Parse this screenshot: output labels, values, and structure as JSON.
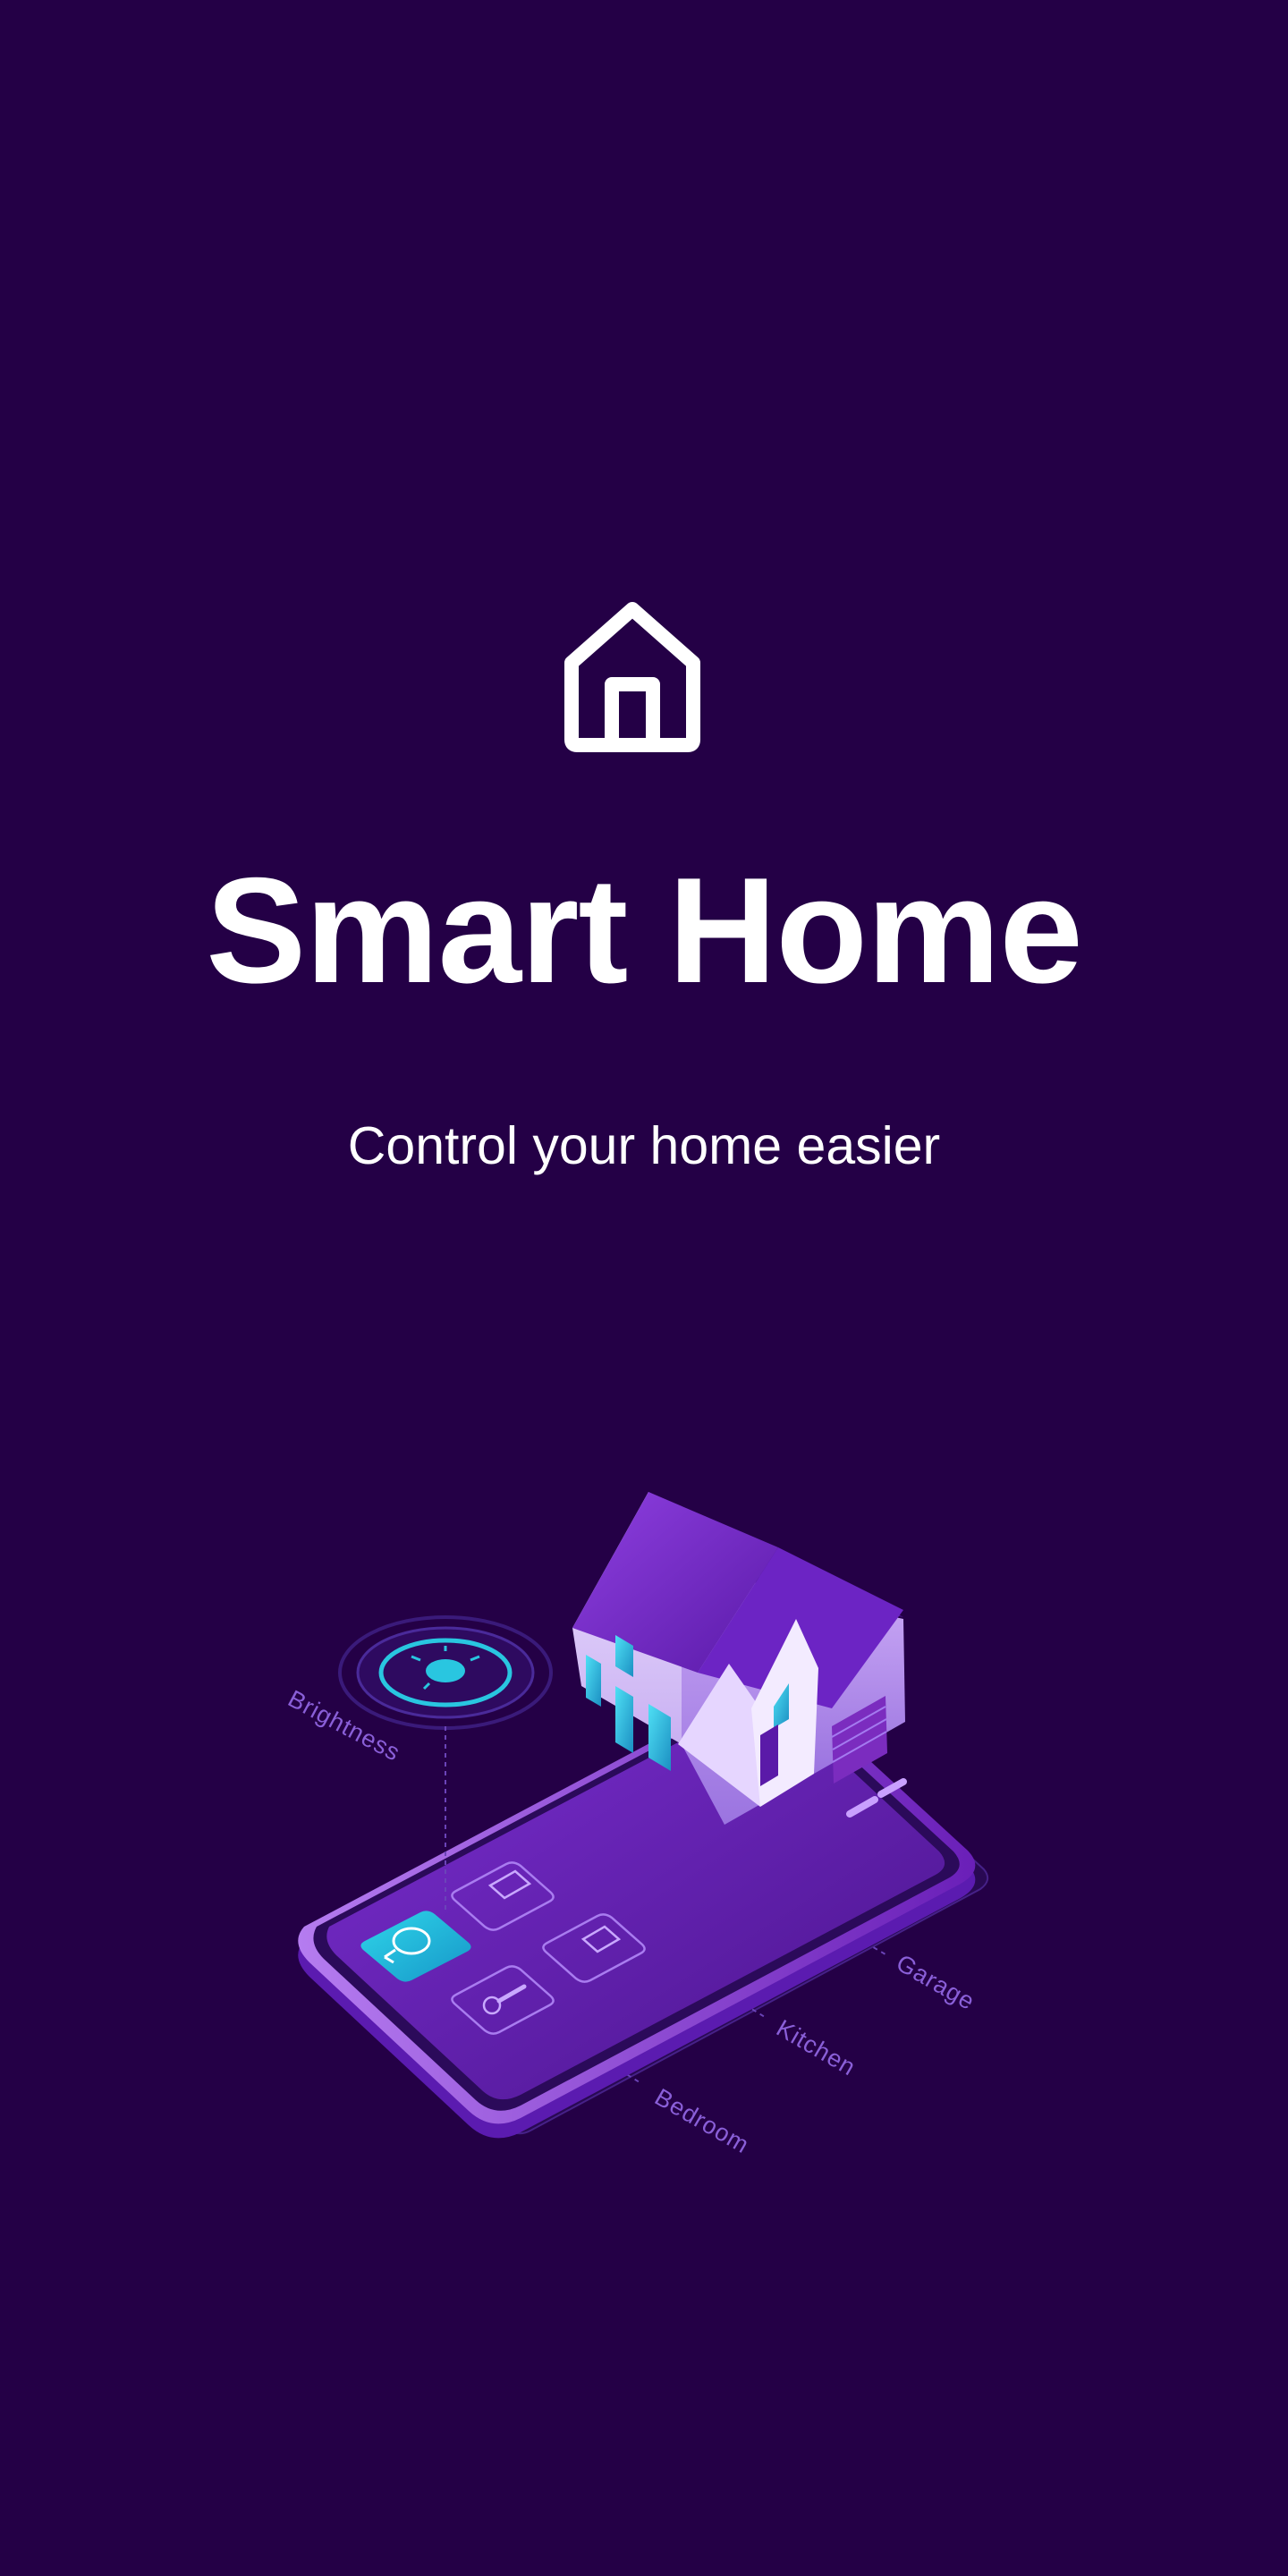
{
  "splash": {
    "icon": "home-icon",
    "title": "Smart Home",
    "subtitle": "Control your home easier"
  },
  "illustration": {
    "labels": {
      "brightness": "Brightness",
      "garage": "Garage",
      "kitchen": "Kitchen",
      "bedroom": "Bedroom"
    }
  },
  "colors": {
    "background": "#240046",
    "text": "#ffffff",
    "accent_purple": "#7b2cbf",
    "accent_cyan": "#29c6e0"
  }
}
